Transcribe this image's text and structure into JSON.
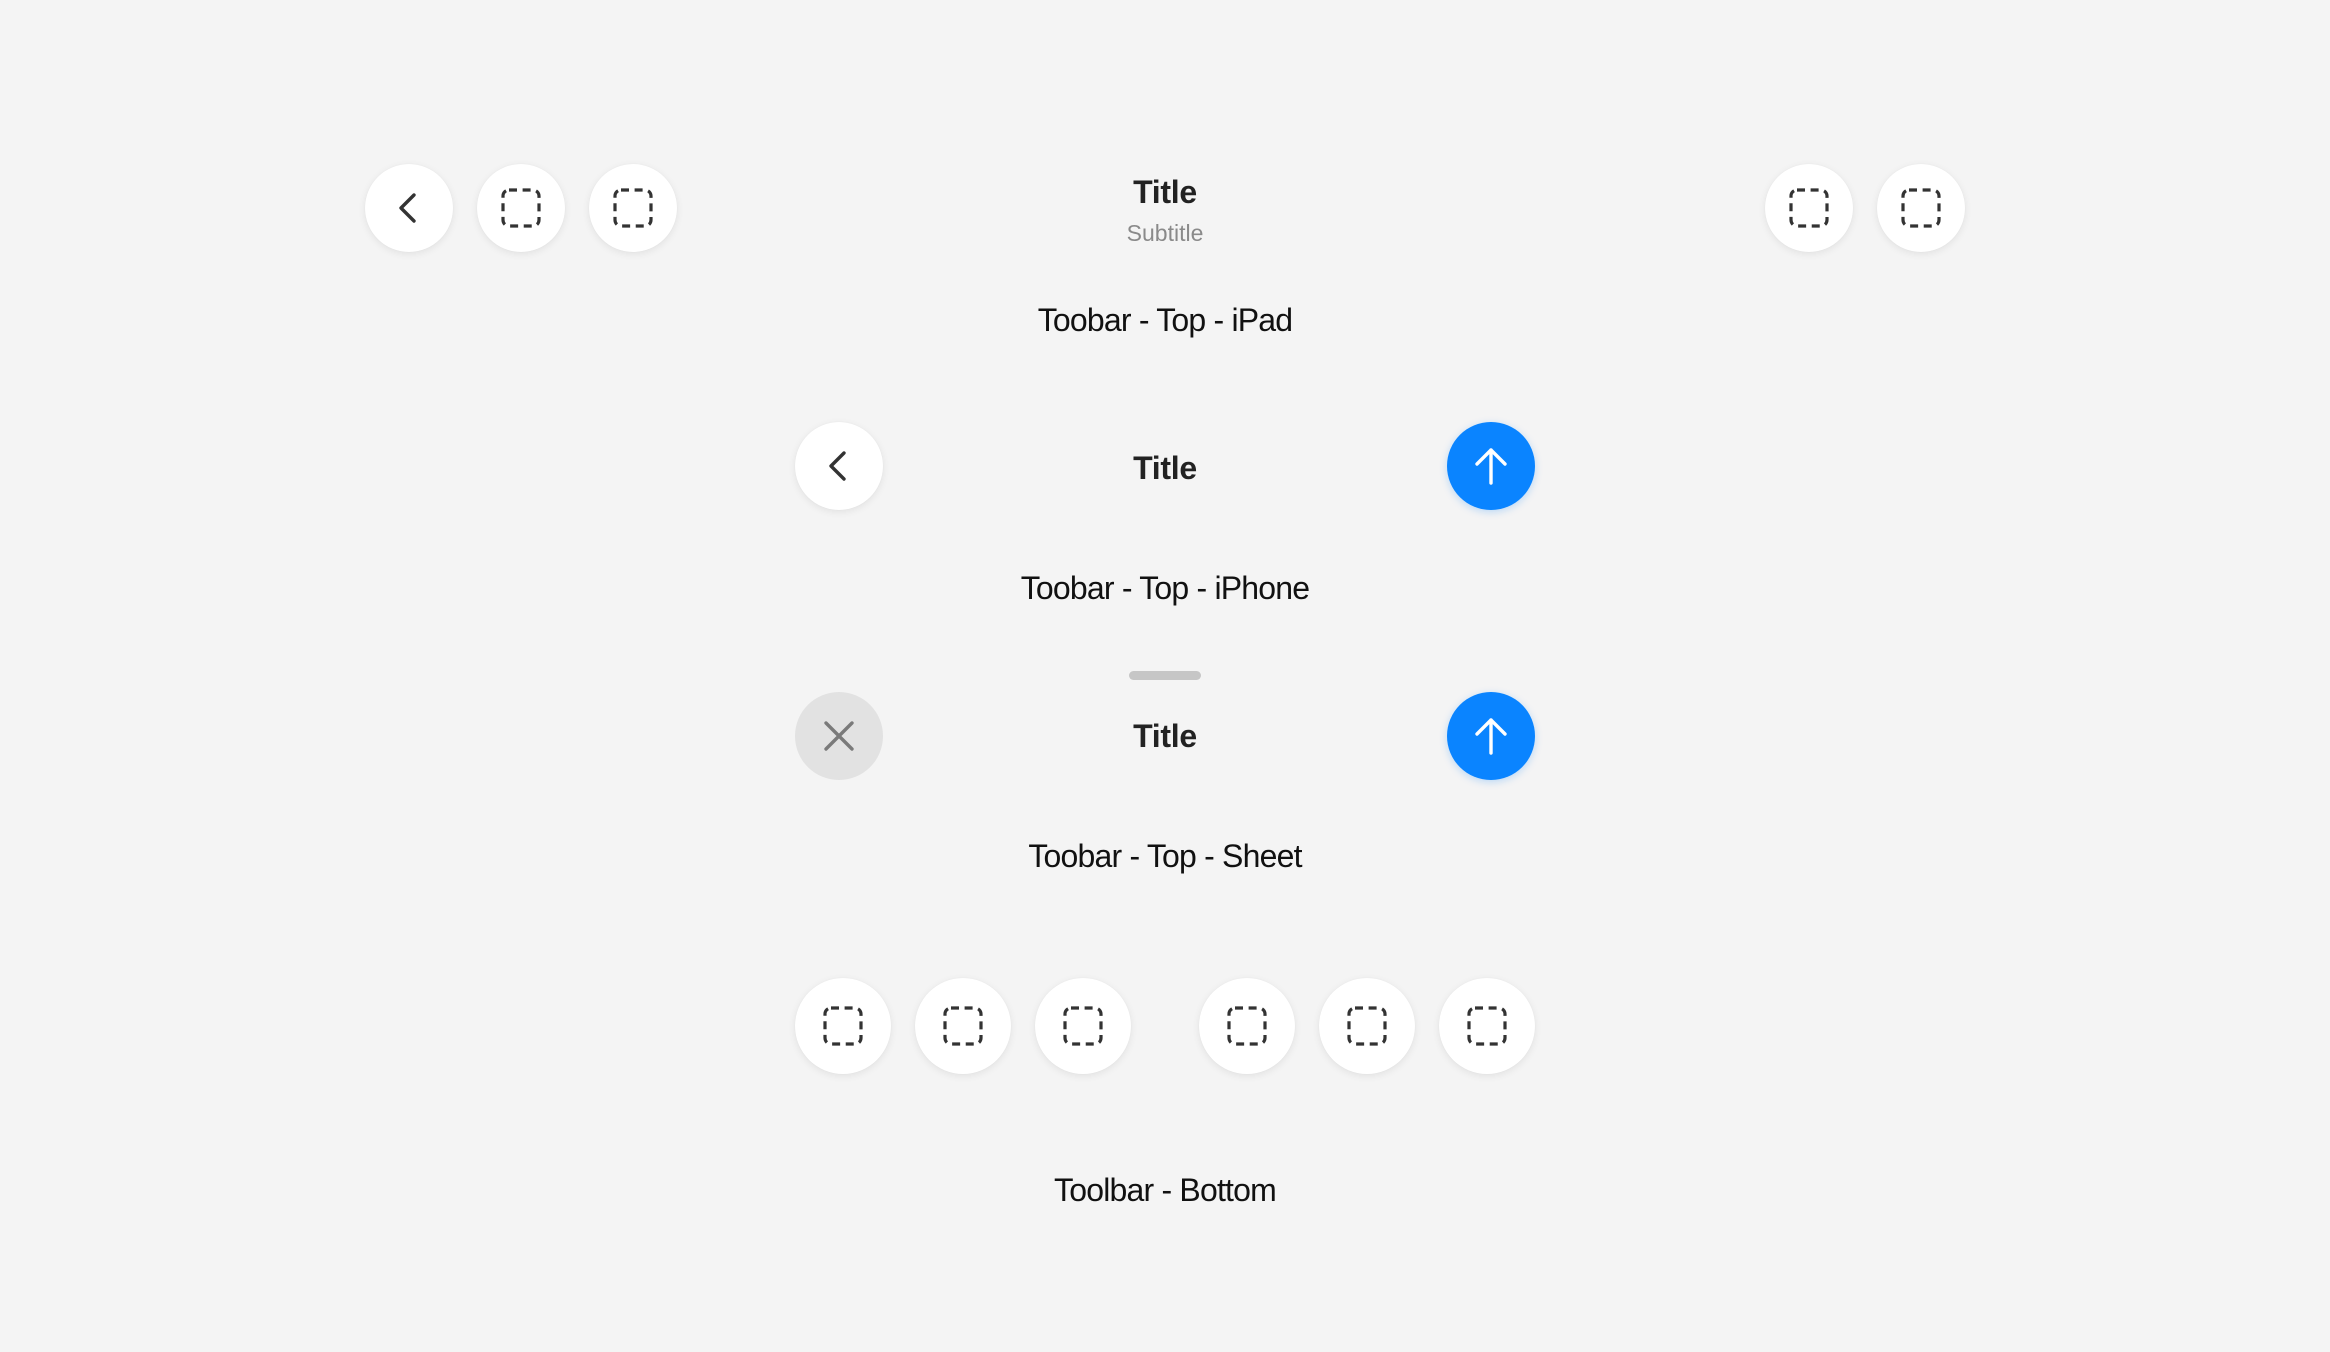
{
  "ipad_toolbar": {
    "title": "Title",
    "subtitle": "Subtitle",
    "caption": "Toobar - Top - iPad",
    "leading_icons": [
      "chevron-left-icon",
      "dashed-square-icon",
      "dashed-square-icon"
    ],
    "trailing_icons": [
      "dashed-square-icon",
      "dashed-square-icon"
    ]
  },
  "iphone_toolbar": {
    "title": "Title",
    "caption": "Toobar - Top - iPhone",
    "leading_icon": "chevron-left-icon",
    "trailing_icon": "arrow-up-icon"
  },
  "sheet_toolbar": {
    "title": "Title",
    "caption": "Toobar - Top - Sheet",
    "leading_icon": "close-icon",
    "trailing_icon": "arrow-up-icon"
  },
  "bottom_toolbar": {
    "caption": "Toolbar - Bottom",
    "left_group_icons": [
      "dashed-square-icon",
      "dashed-square-icon",
      "dashed-square-icon"
    ],
    "right_group_icons": [
      "dashed-square-icon",
      "dashed-square-icon",
      "dashed-square-icon"
    ]
  },
  "colors": {
    "background": "#f4f4f4",
    "accent": "#0a84ff",
    "button": "#ffffff",
    "close_button": "#e2e2e2"
  }
}
